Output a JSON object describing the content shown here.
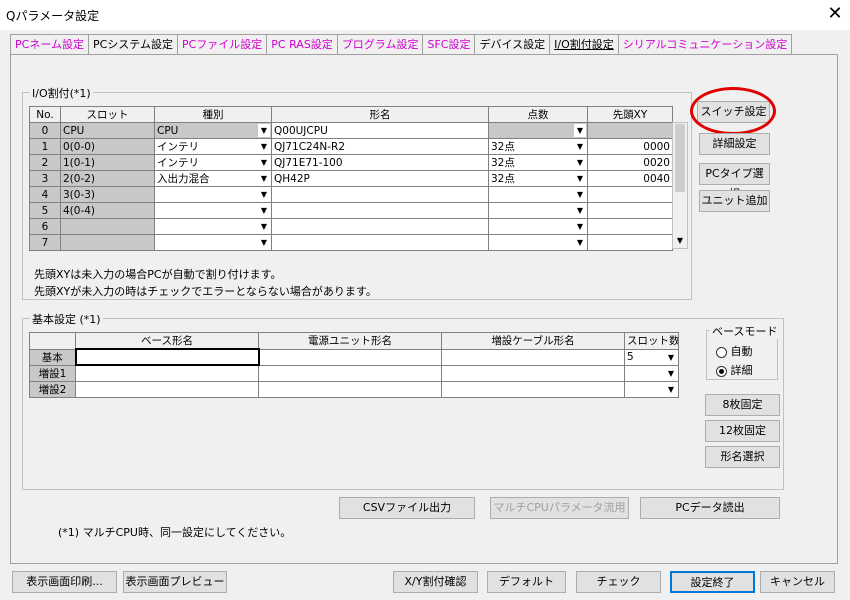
{
  "window": {
    "title": "Qパラメータ設定"
  },
  "tabs": [
    {
      "label": "PCネーム設定",
      "color": "magenta"
    },
    {
      "label": "PCシステム設定",
      "color": "black"
    },
    {
      "label": "PCファイル設定",
      "color": "magenta"
    },
    {
      "label": "PC RAS設定",
      "color": "magenta"
    },
    {
      "label": "プログラム設定",
      "color": "magenta"
    },
    {
      "label": "SFC設定",
      "color": "magenta"
    },
    {
      "label": "デバイス設定",
      "color": "black"
    },
    {
      "label": "I/O割付設定",
      "color": "black",
      "active": true
    },
    {
      "label": "シリアルコミュニケーション設定",
      "color": "magenta"
    }
  ],
  "io": {
    "group_label": "I/O割付(*1)",
    "headers": [
      "No.",
      "スロット",
      "種別",
      "形名",
      "点数",
      "先頭XY"
    ],
    "rows": [
      {
        "no": "0",
        "slot": "CPU",
        "type": "CPU",
        "model": "Q00UJCPU",
        "points": "",
        "xy": ""
      },
      {
        "no": "1",
        "slot": "0(0-0)",
        "type": "インテリ",
        "model": "QJ71C24N-R2",
        "points": "32点",
        "xy": "0000"
      },
      {
        "no": "2",
        "slot": "1(0-1)",
        "type": "インテリ",
        "model": "QJ71E71-100",
        "points": "32点",
        "xy": "0020"
      },
      {
        "no": "3",
        "slot": "2(0-2)",
        "type": "入出力混合",
        "model": "QH42P",
        "points": "32点",
        "xy": "0040"
      },
      {
        "no": "4",
        "slot": "3(0-3)",
        "type": "",
        "model": "",
        "points": "",
        "xy": ""
      },
      {
        "no": "5",
        "slot": "4(0-4)",
        "type": "",
        "model": "",
        "points": "",
        "xy": ""
      },
      {
        "no": "6",
        "slot": "",
        "type": "",
        "model": "",
        "points": "",
        "xy": ""
      },
      {
        "no": "7",
        "slot": "",
        "type": "",
        "model": "",
        "points": "",
        "xy": ""
      }
    ],
    "note1": "先頭XYは未入力の場合PCが自動で割り付けます。",
    "note2": "先頭XYが未入力の時はチェックでエラーとならない場合があります。"
  },
  "side_buttons": {
    "switch": "スイッチ設定",
    "detail": "詳細設定",
    "pc_type": "PCタイプ選択",
    "unit_add": "ユニット追加"
  },
  "base": {
    "group_label": "基本設定 (*1)",
    "headers": [
      "",
      "ベース形名",
      "電源ユニット形名",
      "増設ケーブル形名",
      "スロット数"
    ],
    "rows": [
      {
        "label": "基本",
        "base": "",
        "power": "",
        "cable": "",
        "slots": "5"
      },
      {
        "label": "増設1",
        "base": "",
        "power": "",
        "cable": "",
        "slots": ""
      },
      {
        "label": "増設2",
        "base": "",
        "power": "",
        "cable": "",
        "slots": ""
      }
    ],
    "mode_label": "ベースモード",
    "mode_auto": "自動",
    "mode_detail": "詳細",
    "btn_8": "8枚固定",
    "btn_12": "12枚固定",
    "btn_model": "形名選択"
  },
  "mid_buttons": {
    "csv": "CSVファイル出力",
    "multi": "マルチCPUパラメータ流用",
    "read": "PCデータ読出"
  },
  "footnote": "(*1) マルチCPU時、同一設定にしてください。",
  "bottom_buttons": {
    "print": "表示画面印刷...",
    "preview": "表示画面プレビュー",
    "xy_check": "X/Y割付確認",
    "default": "デフォルト",
    "check": "チェック",
    "finish": "設定終了",
    "cancel": "キャンセル"
  }
}
